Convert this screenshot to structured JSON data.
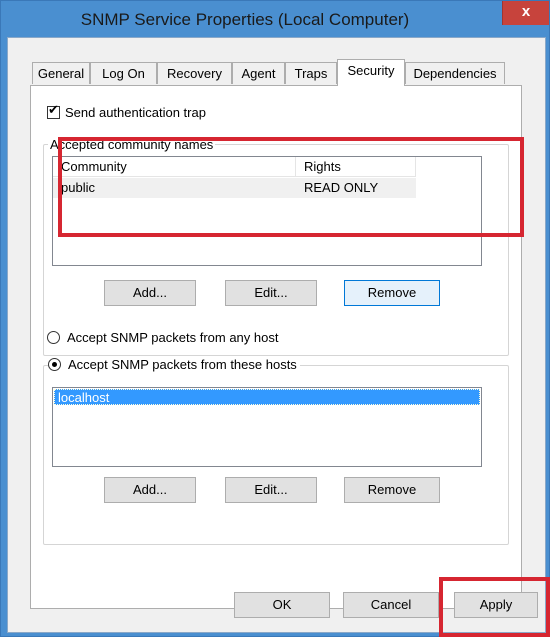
{
  "window": {
    "title": "SNMP Service Properties (Local Computer)",
    "close_label": "x"
  },
  "tabs": [
    {
      "label": "General"
    },
    {
      "label": "Log On"
    },
    {
      "label": "Recovery"
    },
    {
      "label": "Agent"
    },
    {
      "label": "Traps"
    },
    {
      "label": "Security",
      "active": true
    },
    {
      "label": "Dependencies"
    }
  ],
  "security": {
    "send_auth_trap_label": "Send authentication trap",
    "send_auth_trap_checked": true,
    "community_group_label": "Accepted community names",
    "columns": [
      "Community",
      "Rights"
    ],
    "communities": [
      {
        "community": "public",
        "rights": "READ ONLY"
      }
    ],
    "community_buttons": {
      "add": "Add...",
      "edit": "Edit...",
      "remove": "Remove"
    },
    "radio_any_label": "Accept SNMP packets from any host",
    "radio_these_label": "Accept SNMP packets from these hosts",
    "selected_radio": "these",
    "hosts": [
      "localhost"
    ],
    "host_buttons": {
      "add": "Add...",
      "edit": "Edit...",
      "remove": "Remove"
    }
  },
  "footer": {
    "ok": "OK",
    "cancel": "Cancel",
    "apply": "Apply"
  },
  "colors": {
    "annotation": "#d62631",
    "selection": "#3399ff",
    "title_bar": "#4a8fd0"
  }
}
